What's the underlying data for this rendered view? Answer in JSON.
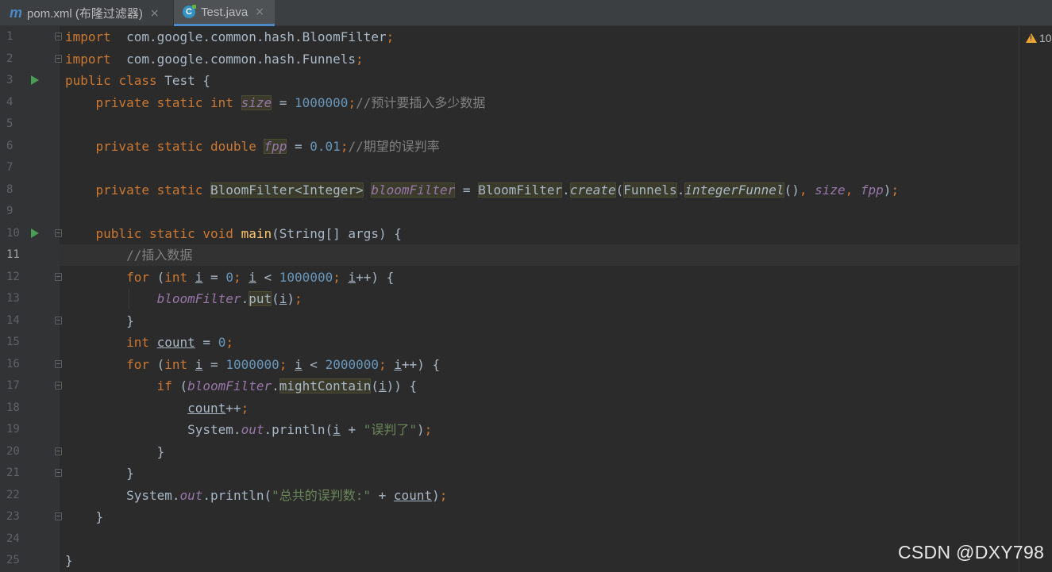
{
  "tabs": [
    {
      "icon": "maven-icon",
      "icon_glyph": "m",
      "label": "pom.xml (布隆过滤器)",
      "close": "×",
      "active": false
    },
    {
      "icon": "java-class-icon",
      "icon_glyph": "C",
      "label": "Test.java",
      "close": "×",
      "active": true
    }
  ],
  "editor": {
    "current_line": 11,
    "warnings_indicator": "10",
    "lines": [
      {
        "n": "1"
      },
      {
        "n": "2"
      },
      {
        "n": "3"
      },
      {
        "n": "4"
      },
      {
        "n": "5"
      },
      {
        "n": "6"
      },
      {
        "n": "7"
      },
      {
        "n": "8"
      },
      {
        "n": "9"
      },
      {
        "n": "10"
      },
      {
        "n": "11"
      },
      {
        "n": "12"
      },
      {
        "n": "13"
      },
      {
        "n": "14"
      },
      {
        "n": "15"
      },
      {
        "n": "16"
      },
      {
        "n": "17"
      },
      {
        "n": "18"
      },
      {
        "n": "19"
      },
      {
        "n": "20"
      },
      {
        "n": "21"
      },
      {
        "n": "22"
      },
      {
        "n": "23"
      },
      {
        "n": "24"
      },
      {
        "n": "25"
      }
    ],
    "code": {
      "l1": {
        "kw": "import",
        "rest": "  com.google.common.hash.BloomFilter",
        "semi": ";"
      },
      "l2": {
        "kw": "import",
        "rest": "  com.google.common.hash.Funnels",
        "semi": ";"
      },
      "l3": {
        "kw1": "public",
        "kw2": "class",
        "name": "Test",
        "brace": "{"
      },
      "l4": {
        "kw": "private static int",
        "field": "size",
        "eq": " = ",
        "num": "1000000",
        "semi": ";",
        "comment": "//预计要插入多少数据"
      },
      "l6": {
        "kw": "private static double",
        "field": "fpp",
        "eq": " = ",
        "num": "0.01",
        "semi": ";",
        "comment": "//期望的误判率"
      },
      "l8": {
        "kw": "private static",
        "type": "BloomFilter<Integer>",
        "field": "bloomFilter",
        "eq": " = ",
        "cls": "BloomFilter",
        "dot": ".",
        "method": "create",
        "open": "(",
        "cls2": "Funnels",
        "dot2": ".",
        "method2": "integerFunnel",
        "call": "()",
        "comma1": ", ",
        "arg1": "size",
        "comma2": ", ",
        "arg2": "fpp",
        "close": ")",
        "semi": ";"
      },
      "l10": {
        "kw": "public static void",
        "method": "main",
        "params": "(String[] args) {"
      },
      "l11": {
        "comment": "//插入数据"
      },
      "l12": {
        "kw": "for",
        "open": " (",
        "kw2": "int",
        "var": "i",
        "eq": " = ",
        "num": "0",
        "semi1": "; ",
        "var2": "i",
        "lt": " < ",
        "num2": "1000000",
        "semi2": "; ",
        "var3": "i",
        "inc": "++) {"
      },
      "l13": {
        "field": "bloomFilter",
        "dot": ".",
        "method": "put",
        "open": "(",
        "var": "i",
        "close": ")",
        "semi": ";"
      },
      "l14": {
        "brace": "}"
      },
      "l15": {
        "kw": "int",
        "var": "count",
        "eq": " = ",
        "num": "0",
        "semi": ";"
      },
      "l16": {
        "kw": "for",
        "open": " (",
        "kw2": "int",
        "var": "i",
        "eq": " = ",
        "num": "1000000",
        "semi1": "; ",
        "var2": "i",
        "lt": " < ",
        "num2": "2000000",
        "semi2": "; ",
        "var3": "i",
        "inc": "++) {"
      },
      "l17": {
        "kw": "if",
        "open": " (",
        "field": "bloomFilter",
        "dot": ".",
        "method": "mightContain",
        "open2": "(",
        "var": "i",
        "close": ")) {"
      },
      "l18": {
        "var": "count",
        "inc": "++",
        "semi": ";"
      },
      "l19": {
        "cls": "System",
        "dot": ".",
        "field": "out",
        "call": ".println(",
        "var": "i",
        "plus": " + ",
        "str": "\"误判了\"",
        "close": ")",
        "semi": ";"
      },
      "l20": {
        "brace": "}"
      },
      "l21": {
        "brace": "}"
      },
      "l22": {
        "cls": "System",
        "dot": ".",
        "field": "out",
        "call": ".println(",
        "str": "\"总共的误判数:\"",
        "plus": " + ",
        "var": "count",
        "close": ")",
        "semi": ";"
      },
      "l23": {
        "brace": "}"
      },
      "l25": {
        "brace": "}"
      }
    }
  },
  "watermark": "CSDN @DXY798",
  "colors": {
    "background": "#2b2b2b",
    "gutter": "#313335",
    "keyword": "#cc7832",
    "number": "#6897bb",
    "string": "#6a8759",
    "comment": "#808080",
    "field": "#9876aa",
    "method": "#ffc66d",
    "text": "#a9b7c6",
    "run_icon": "#499c54"
  }
}
